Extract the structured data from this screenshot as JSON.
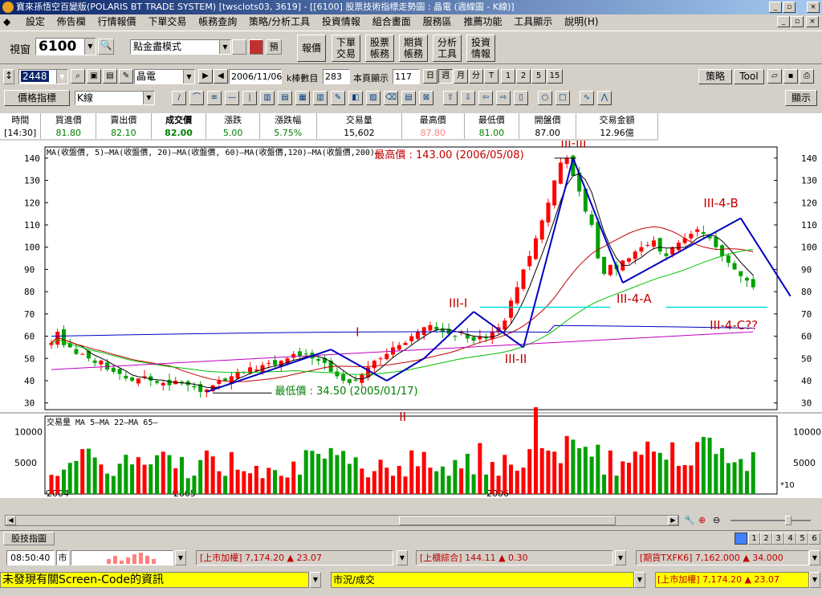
{
  "window": {
    "title": "寶來孫悟空百變版(POLARIS BT TRADE SYSTEM)  [twsclots03, 3619] - [[6100] 股票技術指標走勢圖 : 晶電 (週線圖 - K線)]"
  },
  "menu": [
    "設定",
    "佈告欄",
    "行情報價",
    "下單交易",
    "帳務查詢",
    "策略/分析工具",
    "投資情報",
    "組合畫面",
    "服務區",
    "推薦功能",
    "工具顯示",
    "說明(H)"
  ],
  "toolbar1": {
    "window_label": "視窗",
    "window_code": "6100",
    "mode": "點金盡模式",
    "buttons": [
      "報價",
      "下單\n交易",
      "股票\n帳務",
      "期貨\n帳務",
      "分析\n工具",
      "投資\n情報"
    ]
  },
  "toolbar2": {
    "code": "2448",
    "name": "晶電",
    "date": "2006/11/06",
    "kbar_label": "k棒數目",
    "kbar": "283",
    "page_label": "本頁顯示",
    "page": "117",
    "periods": [
      "日",
      "週",
      "月",
      "分",
      "T",
      "1",
      "2",
      "5",
      "15"
    ],
    "strategy": "策略",
    "tool": "Tool"
  },
  "toolbar3": {
    "indicator": "價格指標",
    "ktype": "K線",
    "display": "顯示"
  },
  "quote": {
    "headers": [
      "時間",
      "買進價",
      "賣出價",
      "成交價",
      "漲跌",
      "漲跌幅",
      "交易量",
      "最高價",
      "最低價",
      "開盤價",
      "交易金額"
    ],
    "values": [
      "[14:30]",
      "81.80",
      "82.10",
      "82.00",
      "5.00",
      "5.75%",
      "15,602",
      "87.80",
      "81.00",
      "87.00",
      "12.96億"
    ]
  },
  "chart_data": {
    "type": "candlestick",
    "ma_legend": "MA(收盤價, 5)—MA(收盤價, 20)—MA(收盤價, 60)—MA(收盤價,120)—MA(收盤價,200)—",
    "vol_legend": "交易量 MA  5—MA 22—MA 65—",
    "y_ticks": [
      30,
      40,
      50,
      60,
      70,
      80,
      90,
      100,
      110,
      120,
      130,
      140
    ],
    "vol_ticks": [
      "10000",
      "5000"
    ],
    "vol_unit": "*10",
    "x_labels": [
      "2004",
      "2005",
      "2006"
    ],
    "annotations": {
      "high": "最高價 : 143.00 (2006/05/08)",
      "low": "最低價 : 34.50 (2005/01/17)",
      "w1": "I",
      "w2": "II",
      "w31": "III-I",
      "w32": "III-II",
      "w33": "III-III",
      "w34a": "III-4-A",
      "w34b": "III-4-B",
      "w34c": "III-4-C??"
    },
    "high": 143.0,
    "low": 34.5,
    "closes": [
      57,
      62,
      56,
      55,
      52,
      52,
      50,
      48,
      49,
      45,
      44,
      43,
      41,
      40,
      41,
      42,
      40,
      39,
      39,
      38,
      40,
      39,
      38,
      37,
      35,
      36,
      38,
      40,
      40,
      42,
      44,
      44,
      46,
      45,
      47,
      48,
      47,
      49,
      50,
      52,
      51,
      52,
      50,
      49,
      48,
      44,
      42,
      40,
      39,
      40,
      43,
      46,
      49,
      50,
      52,
      55,
      56,
      57,
      60,
      62,
      64,
      65,
      63,
      62,
      61,
      60,
      62,
      59,
      58,
      60,
      59,
      62,
      64,
      67,
      76,
      82,
      90,
      96,
      104,
      112,
      120,
      130,
      138,
      140,
      132,
      125,
      116,
      110,
      95,
      88,
      92,
      90,
      94,
      95,
      98,
      100,
      101,
      103,
      98,
      96,
      100,
      102,
      104,
      106,
      108,
      106,
      104,
      100,
      96,
      93,
      90,
      87,
      85,
      82
    ]
  },
  "bottom": {
    "tab": "股技指圖",
    "pages": [
      "1",
      "2",
      "3",
      "4",
      "5",
      "6"
    ],
    "clock": "08:50:40",
    "market": "市",
    "ticker1": "[上市加權]  7,174.20  ▲ 23.07",
    "ticker2": "[上櫃綜合]  144.11  ▲ 0.30",
    "ticker3": "[期貨TXFK6]  7,162.000  ▲ 34.000",
    "status": "未發現有關Screen-Code的資訊",
    "status2": "市況/成交",
    "ticker4": "[上市加權]  7,174.20  ▲ 23.07"
  },
  "colors": {
    "up": "#ff0000",
    "down": "#00a000",
    "ma5": "#000000",
    "ma20": "#c00000",
    "ma60": "#00c000",
    "ma120": "#0000c0",
    "ma200": "#c000c0"
  }
}
